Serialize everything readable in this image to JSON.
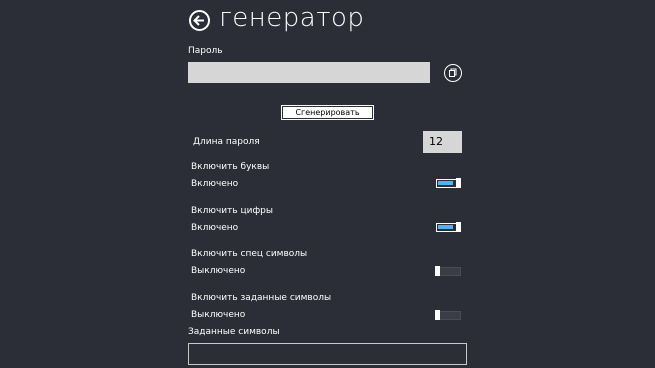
{
  "header": {
    "title": "генератор"
  },
  "password": {
    "label": "Пароль",
    "value": ""
  },
  "generate_button": {
    "label": "Сгенерировать"
  },
  "length": {
    "label": "Длина пароля",
    "value": "12"
  },
  "options": [
    {
      "label": "Включить буквы",
      "state_label": "Включено",
      "on": true
    },
    {
      "label": "Включить цифры",
      "state_label": "Включено",
      "on": true
    },
    {
      "label": "Включить спец символы",
      "state_label": "Выключено",
      "on": false
    },
    {
      "label": "Включить заданные символы",
      "state_label": "Выключено",
      "on": false
    }
  ],
  "custom_symbols": {
    "label": "Заданные символы",
    "value": ""
  },
  "colors": {
    "background": "#2b2e37",
    "field": "#d6d6d6",
    "toggle_on": "#4fb3f0",
    "text": "#ffffff"
  },
  "icons": {
    "back": "back-arrow-icon",
    "copy": "copy-icon"
  }
}
